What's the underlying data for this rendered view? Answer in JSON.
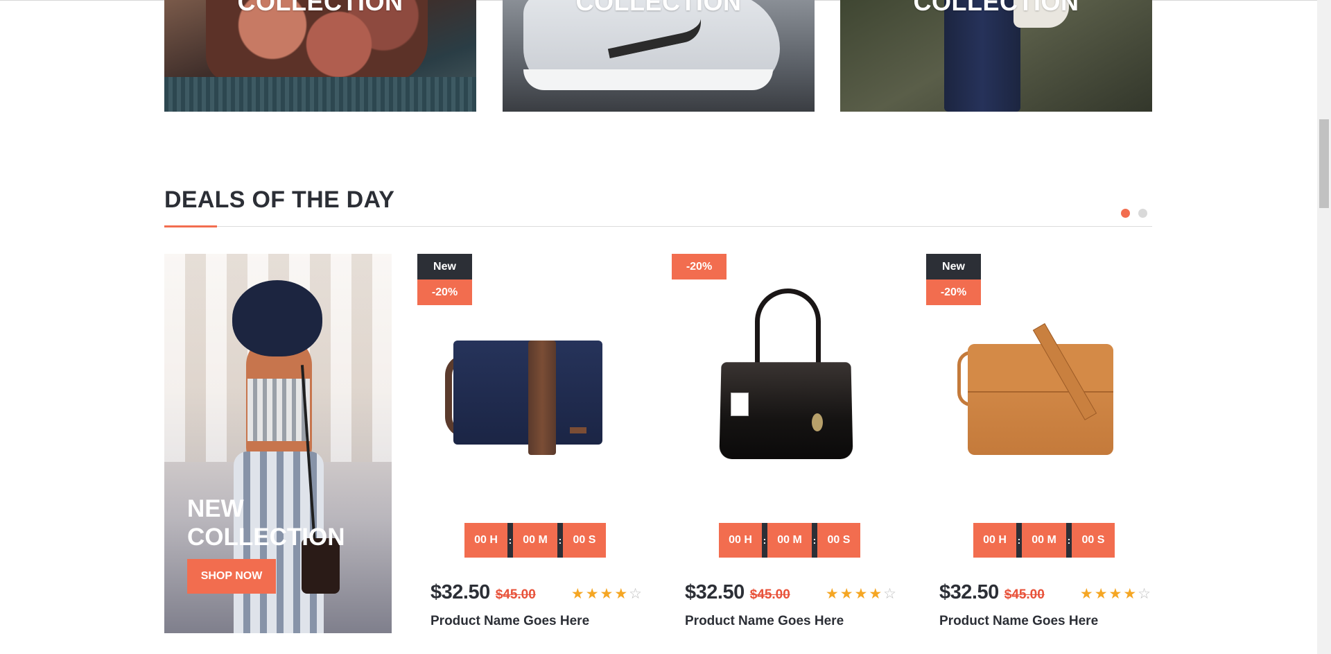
{
  "collections": [
    {
      "title": "COLLECTION"
    },
    {
      "title": "COLLECTION"
    },
    {
      "title": "COLLECTION"
    }
  ],
  "deals": {
    "heading": "DEALS OF THE DAY",
    "pagination": {
      "pages": 2,
      "active": 1
    }
  },
  "promo": {
    "title_line1": "NEW",
    "title_line2": "COLLECTION",
    "button": "SHOP NOW"
  },
  "products": [
    {
      "badges": [
        "New",
        "-20%"
      ],
      "image_icon": "navy-messenger-bag",
      "timer": {
        "hours": "00 H",
        "minutes": "00 M",
        "seconds": "00 S",
        "separator": ":"
      },
      "price": "$32.50",
      "old_price": "$45.00",
      "rating": 4,
      "rating_max": 5,
      "name": "Product Name Goes Here"
    },
    {
      "badges": [
        "-20%"
      ],
      "image_icon": "black-handbag",
      "timer": {
        "hours": "00 H",
        "minutes": "00 M",
        "seconds": "00 S",
        "separator": ":"
      },
      "price": "$32.50",
      "old_price": "$45.00",
      "rating": 4,
      "rating_max": 5,
      "name": "Product Name Goes Here"
    },
    {
      "badges": [
        "New",
        "-20%"
      ],
      "image_icon": "tan-leather-briefcase",
      "timer": {
        "hours": "00 H",
        "minutes": "00 M",
        "seconds": "00 S",
        "separator": ":"
      },
      "price": "$32.50",
      "old_price": "$45.00",
      "rating": 4,
      "rating_max": 5,
      "name": "Product Name Goes Here"
    }
  ],
  "colors": {
    "accent": "#f26d4f",
    "dark": "#2c2f36",
    "star": "#f5a623",
    "old_price": "#e8523a"
  }
}
